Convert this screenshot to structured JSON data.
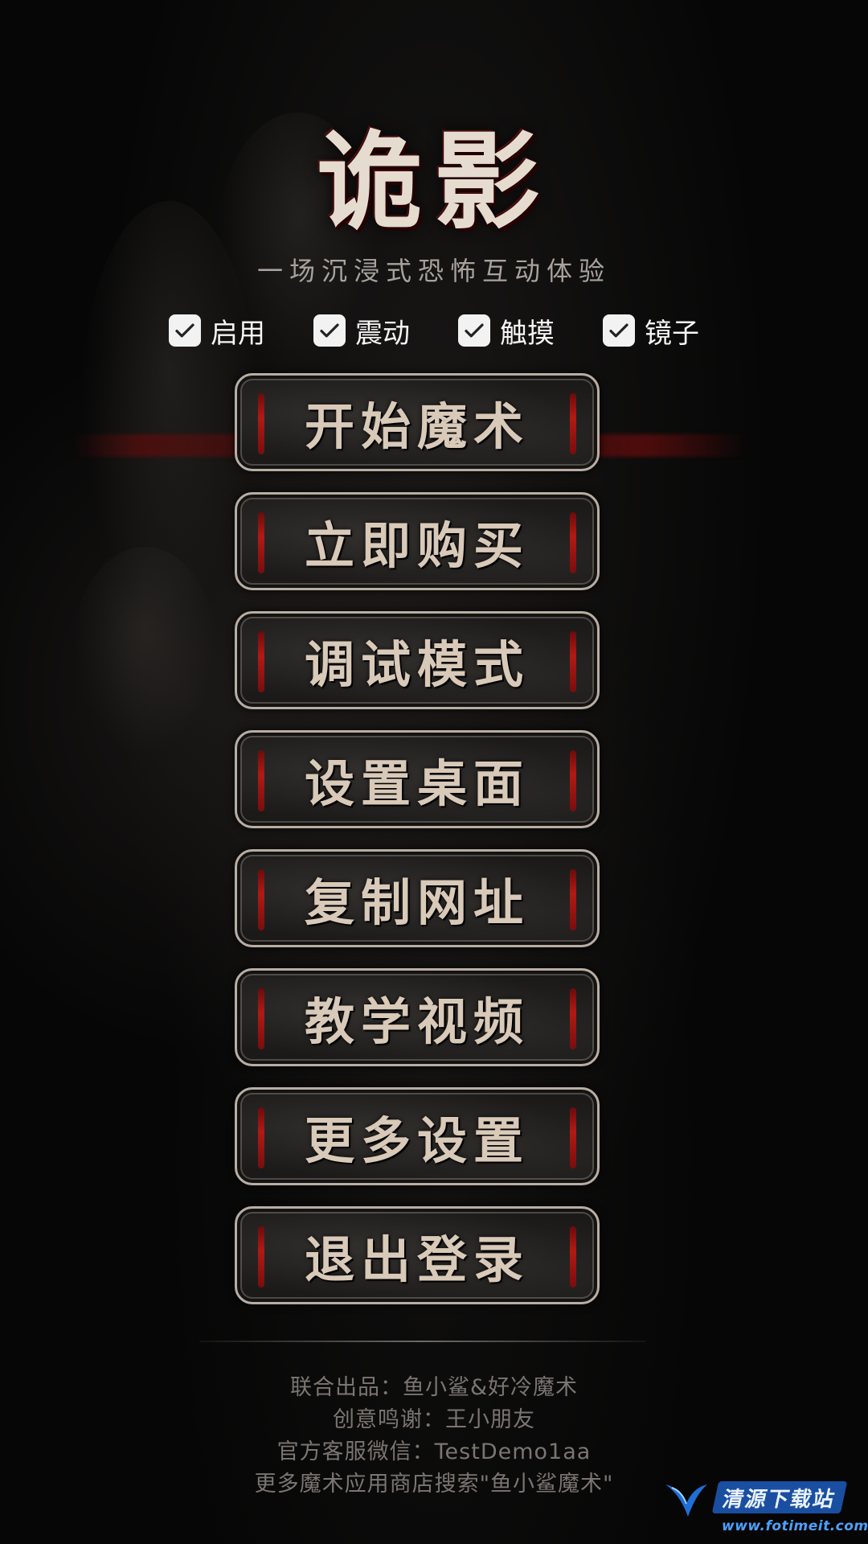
{
  "app": {
    "title": "诡影",
    "subtitle": "一场沉浸式恐怖互动体验"
  },
  "options": [
    {
      "label": "启用",
      "checked": true
    },
    {
      "label": "震动",
      "checked": true
    },
    {
      "label": "触摸",
      "checked": true
    },
    {
      "label": "镜子",
      "checked": true
    }
  ],
  "menu": [
    {
      "label": "开始魔术"
    },
    {
      "label": "立即购买"
    },
    {
      "label": "调试模式"
    },
    {
      "label": "设置桌面"
    },
    {
      "label": "复制网址"
    },
    {
      "label": "教学视频"
    },
    {
      "label": "更多设置"
    },
    {
      "label": "退出登录"
    }
  ],
  "credits": {
    "line1": "联合出品：鱼小鲨&好冷魔术",
    "line2": "创意鸣谢：王小朋友",
    "line3": "官方客服微信：TestDemo1aa",
    "line4": "更多魔术应用商店搜索\"鱼小鲨魔术\""
  },
  "watermark": {
    "title": "清源下载站",
    "url": "www.fotimeit.com"
  },
  "colors": {
    "background": "#050505",
    "accent_red": "#b21a14",
    "button_border": "#b9ada2",
    "button_text": "#d8c9b8"
  }
}
